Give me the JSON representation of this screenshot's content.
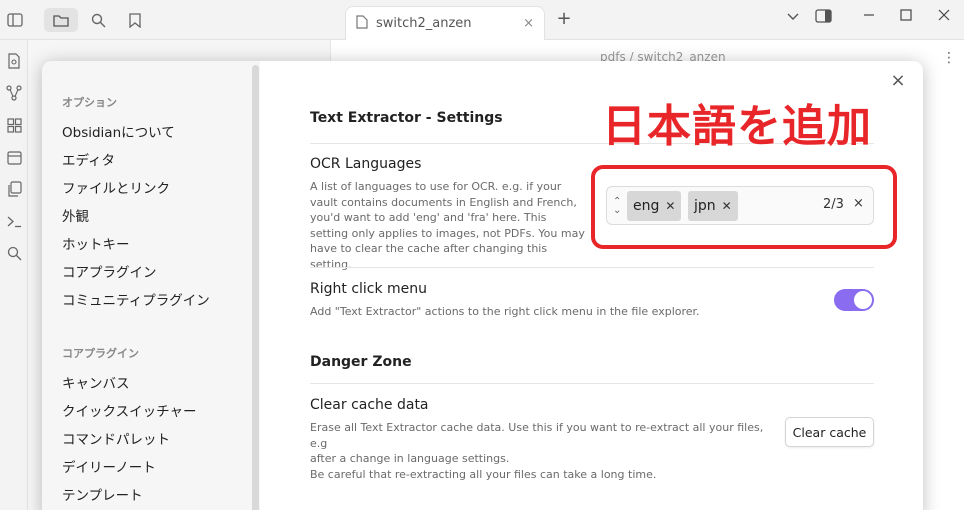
{
  "topbar": {
    "tab_title": "switch2_anzen",
    "new_tab": "+",
    "close_tab": "×"
  },
  "background": {
    "breadcrumb": "pdfs / switch2_anzen"
  },
  "modal": {
    "close": "×",
    "sidebar": {
      "sections": [
        {
          "heading": "オプション",
          "items": [
            "Obsidianについて",
            "エディタ",
            "ファイルとリンク",
            "外観",
            "ホットキー",
            "コアプラグイン",
            "コミュニティプラグイン"
          ]
        },
        {
          "heading": "コアプラグイン",
          "items": [
            "キャンバス",
            "クイックスイッチャー",
            "コマンドパレット",
            "デイリーノート",
            "テンプレート"
          ]
        }
      ]
    },
    "content": {
      "title": "Text Extractor - Settings",
      "ocr": {
        "name": "OCR Languages",
        "desc": "A list of languages to use for OCR. e.g. if your vault contains documents in English and French, you'd want to add 'eng' and 'fra' here. This setting only applies to images, not PDFs. You may have to clear the cache after changing this setting.",
        "chips": [
          "eng",
          "jpn"
        ],
        "count": "2/3",
        "clear": "×"
      },
      "right_click": {
        "name": "Right click menu",
        "desc": "Add \"Text Extractor\" actions to the right click menu in the file explorer.",
        "enabled": true
      },
      "danger_title": "Danger Zone",
      "clear_cache": {
        "name": "Clear cache data",
        "desc_lines": [
          "Erase all Text Extractor cache data. Use this if you want to re-extract all your files, e.g",
          "after a change in language settings.",
          "Be careful that re-extracting all your files can take a long time."
        ],
        "button": "Clear cache"
      }
    }
  },
  "annotation": {
    "text": "日本語を追加",
    "color": "#e8262a"
  },
  "colors": {
    "accent": "#8a6cf0"
  }
}
